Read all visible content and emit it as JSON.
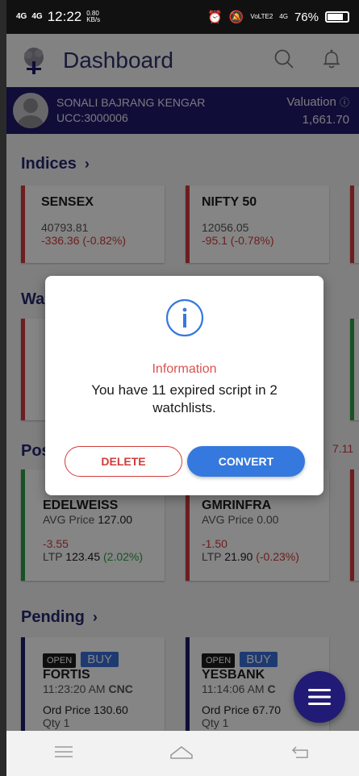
{
  "status_bar": {
    "signal1": "4G",
    "signal2": "4G",
    "time": "12:22",
    "speed": "0.80",
    "speed_unit": "KB/s",
    "net": "VoLTE2",
    "net2": "4G",
    "battery": "76%"
  },
  "header": {
    "title": "Dashboard"
  },
  "profile": {
    "name": "SONALI BAJRANG KENGAR",
    "ucc": "UCC:3000006",
    "valuation_label": "Valuation",
    "valuation": "1,661.70"
  },
  "indices": {
    "heading": "Indices",
    "items": [
      {
        "name": "SENSEX",
        "value": "40793.81",
        "change": "-336.36 (-0.82%)"
      },
      {
        "name": "NIFTY 50",
        "value": "12056.05",
        "change": "-95.1 (-0.78%)"
      }
    ]
  },
  "watchlist": {
    "heading_partial": "Wa"
  },
  "positions": {
    "heading_partial": "Pos",
    "right_value_partial": "7.11",
    "items": [
      {
        "name": "EDELWEISS",
        "avg_label": "AVG Price",
        "avg": "127.00",
        "pnl": "-3.55",
        "ltp_label": "LTP",
        "ltp": "123.45",
        "ltp_change": "(2.02%)"
      },
      {
        "name": "GMRINFRA",
        "avg_label": "AVG Price",
        "avg": "0.00",
        "pnl": "-1.50",
        "ltp_label": "LTP",
        "ltp": "21.90",
        "ltp_change": "(-0.23%)"
      }
    ]
  },
  "pending": {
    "heading": "Pending",
    "items": [
      {
        "status": "OPEN",
        "side": "BUY",
        "name": "FORTIS",
        "time": "11:23:20 AM",
        "product": "CNC",
        "ord_label": "Ord Price",
        "ord_price": "130.60",
        "qty": "Qty 1"
      },
      {
        "status": "OPEN",
        "side": "BUY",
        "name": "YESBANK",
        "time": "11:14:06 AM",
        "product": "C",
        "ord_label": "Ord Price",
        "ord_price": "67.70",
        "qty": "Qty 1"
      }
    ]
  },
  "dialog": {
    "title": "Information",
    "message": "You have 11 expired script in 2 watchlists.",
    "delete_label": "DELETE",
    "convert_label": "CONVERT"
  },
  "colors": {
    "navy": "#1f1a6b",
    "red": "#d23b3b",
    "green": "#2e9e46",
    "blue": "#3579df"
  },
  "icons": [
    "logo-icon",
    "search-icon",
    "bell-icon",
    "info-icon",
    "menu-icon",
    "nav-menu-icon",
    "nav-home-icon",
    "nav-back-icon"
  ]
}
